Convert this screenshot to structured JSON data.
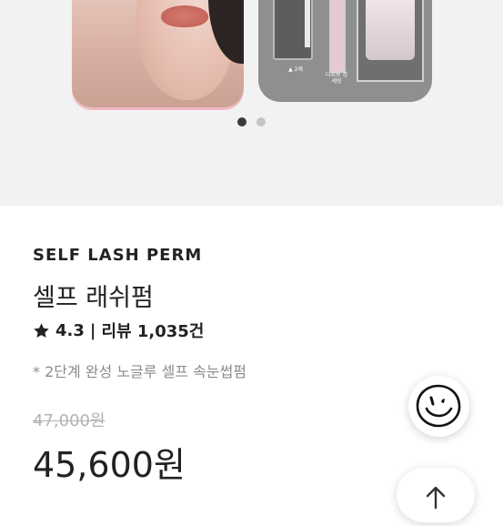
{
  "gallery": {
    "kit_labels": [
      "▲ 2제",
      "다회용 섬세빗"
    ],
    "indicator": {
      "count": 2,
      "active_index": 0
    }
  },
  "product": {
    "brand": "SELF LASH PERM",
    "name": "셀프 래쉬펌",
    "rating": "4.3",
    "separator": "|",
    "reviews": "리뷰 1,035건",
    "description": "* 2단계 완성 노글루 셀프 속눈썹펌",
    "original_price": "47,000원",
    "sale_price": "45,600원"
  },
  "icons": {
    "rating_star": "star-icon",
    "chatbot": "smiley-face-icon",
    "scroll_top": "arrow-up-icon"
  },
  "colors": {
    "text": "#222222",
    "muted": "#8c8c8c",
    "strike": "#b3b3b3",
    "gallery_bg": "#f2f2f2"
  }
}
